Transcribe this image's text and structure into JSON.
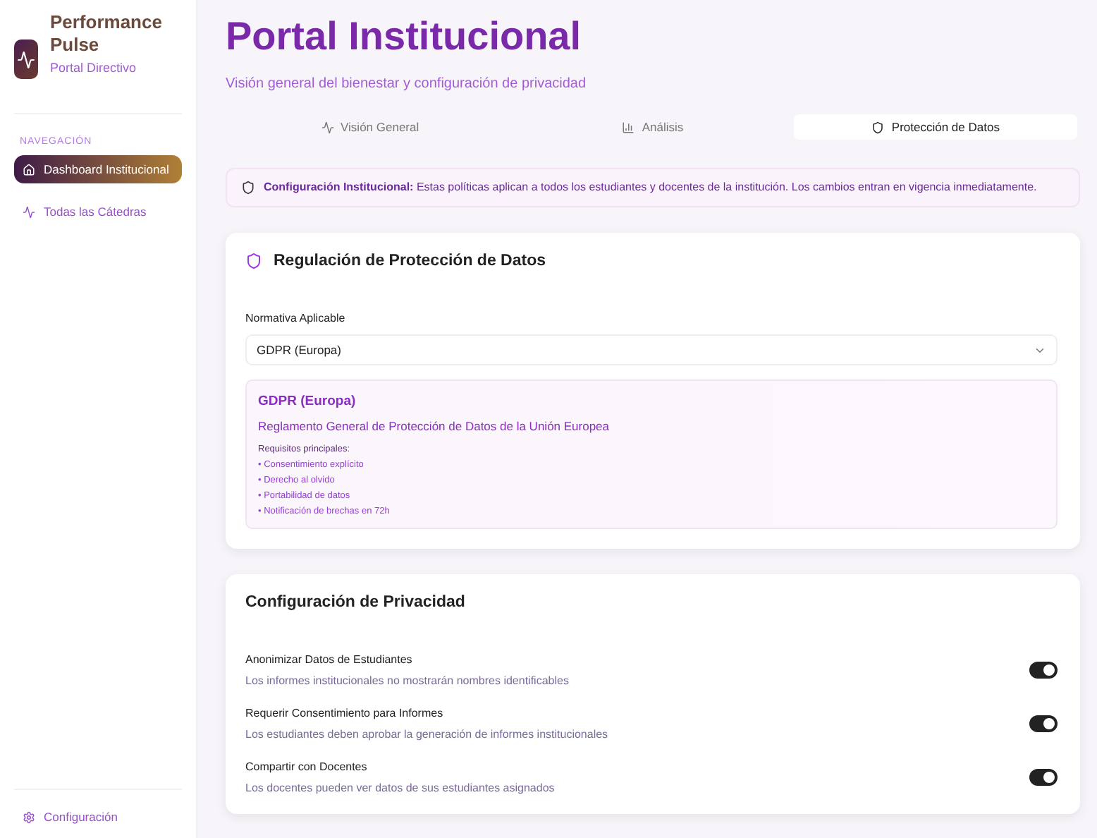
{
  "sidebar": {
    "app_name": "Performance Pulse",
    "app_subtitle": "Portal Directivo",
    "section_label": "NAVEGACIÓN",
    "items": [
      {
        "label": "Dashboard Institucional",
        "selected": true
      },
      {
        "label": "Todas las Cátedras",
        "selected": false
      }
    ],
    "footer_item": {
      "label": "Configuración"
    }
  },
  "header": {
    "title": "Portal Institucional",
    "subtitle": "Visión general del bienestar y configuración de privacidad"
  },
  "tabs": [
    {
      "label": "Visión General",
      "selected": false
    },
    {
      "label": "Análisis",
      "selected": false
    },
    {
      "label": "Protección de Datos",
      "selected": true
    }
  ],
  "alert": {
    "text": "**Configuración Institucional:** Estas políticas aplican a todos los estudiantes y docentes de la institución. Los cambios entran en vigencia inmediatamente."
  },
  "regulation_card": {
    "title": "Regulación de Protección de Datos",
    "field_label": "Normativa Aplicable",
    "select_value": "GDPR (Europa)",
    "info": {
      "title": "GDPR (Europa)",
      "description": "Reglamento General de Protección de Datos de la Unión Europea",
      "requirements_label": "Requisitos principales:",
      "requirements": [
        "• Consentimiento explícito",
        "• Derecho al olvido",
        "• Portabilidad de datos",
        "• Notificación de brechas en 72h"
      ]
    }
  },
  "privacy_card": {
    "title": "Configuración de Privacidad",
    "settings": [
      {
        "label": "Anonimizar Datos de Estudiantes",
        "description": "Los informes institucionales no mostrarán nombres identificables",
        "on": true
      },
      {
        "label": "Requerir Consentimiento para Informes",
        "description": "Los estudiantes deben aprobar la generación de informes institucionales",
        "on": true
      },
      {
        "label": "Compartir con Docentes",
        "description": "Los docentes pueden ver datos de sus estudiantes asignados",
        "on": true
      }
    ]
  }
}
